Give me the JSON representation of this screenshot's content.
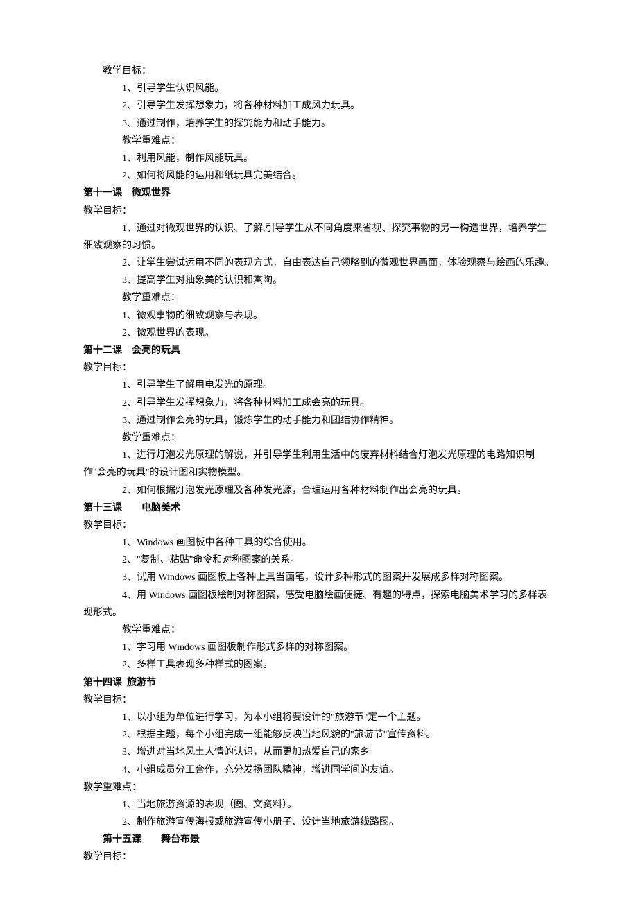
{
  "lines": [
    {
      "text": "教学目标：",
      "indent": 1,
      "bold": false
    },
    {
      "text": "1、引导学生认识风能。",
      "indent": 2,
      "bold": false
    },
    {
      "text": "2、引导学生发挥想象力，将各种材料加工成风力玩具。",
      "indent": 2,
      "bold": false
    },
    {
      "text": "3、通过制作，培养学生的探究能力和动手能力。",
      "indent": 2,
      "bold": false
    },
    {
      "text": "教学重难点：",
      "indent": 2,
      "bold": false
    },
    {
      "text": "1、利用风能，制作风能玩具。",
      "indent": 2,
      "bold": false
    },
    {
      "text": "2、如何将风能的运用和纸玩具完美结合。",
      "indent": 2,
      "bold": false
    },
    {
      "text": "第十一课　微观世界",
      "indent": 0,
      "bold": true
    },
    {
      "text": "教学目标：",
      "indent": 0,
      "bold": false
    },
    {
      "text": "1、通过对微观世界的认识、了解,引导学生从不同角度来省视、探究事物的另一构造世界，培养学生细致观察的习惯。",
      "indent": 2,
      "bold": false
    },
    {
      "text": "2、让学生尝试运用不同的表现方式，自由表达自己领略到的微观世界画面，体验观察与绘画的乐趣。",
      "indent": 2,
      "bold": false
    },
    {
      "text": "3、提高学生对抽象美的认识和熏陶。",
      "indent": 2,
      "bold": false
    },
    {
      "text": "教学重难点：",
      "indent": 2,
      "bold": false
    },
    {
      "text": "1、微观事物的细致观察与表现。",
      "indent": 2,
      "bold": false
    },
    {
      "text": "2、微观世界的表现。",
      "indent": 2,
      "bold": false
    },
    {
      "text": "第十二课　会亮的玩具",
      "indent": 0,
      "bold": true
    },
    {
      "text": "教学目标：",
      "indent": 0,
      "bold": false
    },
    {
      "text": "1、引导学生了解用电发光的原理。",
      "indent": 2,
      "bold": false
    },
    {
      "text": "2、引导学生发挥想象力，将各种材料加工成会亮的玩具。",
      "indent": 2,
      "bold": false
    },
    {
      "text": "3、通过制作会亮的玩具，锻炼学生的动手能力和团结协作精神。",
      "indent": 2,
      "bold": false
    },
    {
      "text": "教学重难点：",
      "indent": 2,
      "bold": false
    },
    {
      "text": "1、进行灯泡发光原理的解说，并引导学生利用生活中的废弃材料结合灯泡发光原理的电路知识制作\"会亮的玩具\"的设计图和实物模型。",
      "indent": 2,
      "bold": false
    },
    {
      "text": "2、如何根据灯泡发光原理及各种发光源，合理运用各种材料制作出会亮的玩具。",
      "indent": 2,
      "bold": false
    },
    {
      "text": "第十三课　　电脑美术",
      "indent": 0,
      "bold": true
    },
    {
      "text": "教学目标：",
      "indent": 0,
      "bold": false
    },
    {
      "text": "1、Windows 画图板中各种工具的综合使用。",
      "indent": 2,
      "bold": false
    },
    {
      "text": "2、\"复制、粘贴\"命令和对称图案的关系。",
      "indent": 2,
      "bold": false
    },
    {
      "text": "3、试用 Windows 画图板上各种上具当画笔，设计多种形式的图案并发展成多样对称图案。",
      "indent": 2,
      "bold": false
    },
    {
      "text": "4、用 Windows 画图板绘制对称图案，感受电脑绘画便捷、有趣的特点，探索电脑美术学习的多样表现形式。",
      "indent": 2,
      "bold": false
    },
    {
      "text": "教学重难点：",
      "indent": 2,
      "bold": false
    },
    {
      "text": "1、学习用 Windows 画图板制作形式多样的对称图案。",
      "indent": 2,
      "bold": false
    },
    {
      "text": "2、多样工具表现多种样式的图案。",
      "indent": 2,
      "bold": false
    },
    {
      "text": "第十四课  旅游节",
      "indent": 0,
      "bold": true
    },
    {
      "text": "教学目标：",
      "indent": 0,
      "bold": false
    },
    {
      "text": "1、以小组为单位进行学习，为本小组将要设计的\"旅游节\"定一个主题。",
      "indent": 2,
      "bold": false
    },
    {
      "text": "2、根据主题，每个小组完成一组能够反映当地风貌的\"旅游节\"宣传资料。",
      "indent": 2,
      "bold": false
    },
    {
      "text": "3、增进对当地风土人情的认识，从而更加热爱自己的家乡",
      "indent": 2,
      "bold": false
    },
    {
      "text": "4、小组成员分工合作，充分发扬团队精神，增进同学间的友谊。",
      "indent": 2,
      "bold": false
    },
    {
      "text": "教学重难点：",
      "indent": 0,
      "bold": false
    },
    {
      "text": "1、当地旅游资源的表现（图、文资料）。",
      "indent": 2,
      "bold": false
    },
    {
      "text": "2、制作旅游宣传海报或旅游宣传小册子、设计当地旅游线路图。",
      "indent": 2,
      "bold": false
    },
    {
      "text": "第十五课　　舞台布景",
      "indent": 1,
      "bold": true
    },
    {
      "text": "教学目标：",
      "indent": 0,
      "bold": false
    }
  ]
}
